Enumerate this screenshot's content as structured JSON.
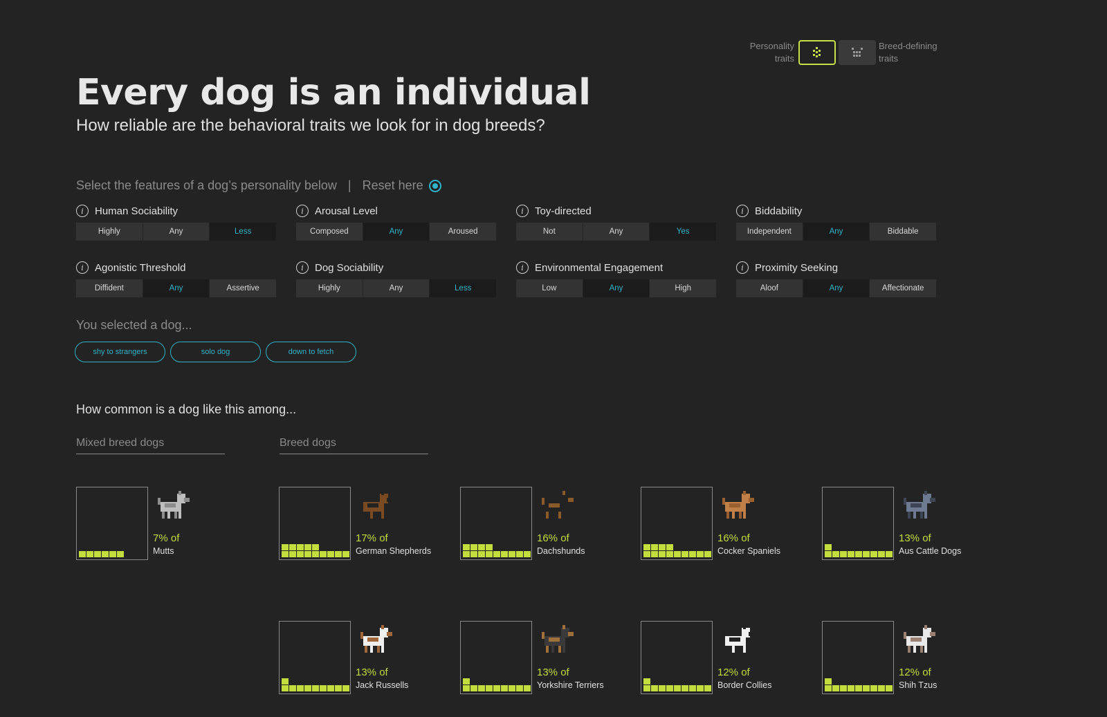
{
  "toggle": {
    "left_label_1": "Personality",
    "left_label_2": "traits",
    "right_label_1": "Breed-defining",
    "right_label_2": "traits"
  },
  "header": {
    "title": "Every dog is an individual",
    "subtitle": "How reliable are the behavioral traits we look for in dog breeds?"
  },
  "selector": {
    "prompt": "Select the features of a dog’s personality below",
    "separator": "|",
    "reset": "Reset here"
  },
  "traits": [
    {
      "name": "Human Sociability",
      "options": [
        "Highly",
        "Any",
        "Less"
      ],
      "selected": 2
    },
    {
      "name": "Arousal Level",
      "options": [
        "Composed",
        "Any",
        "Aroused"
      ],
      "selected": 1
    },
    {
      "name": "Toy-directed",
      "options": [
        "Not",
        "Any",
        "Yes"
      ],
      "selected": 2
    },
    {
      "name": "Biddability",
      "options": [
        "Independent",
        "Any",
        "Biddable"
      ],
      "selected": 1
    },
    {
      "name": "Agonistic Threshold",
      "options": [
        "Diffident",
        "Any",
        "Assertive"
      ],
      "selected": 1
    },
    {
      "name": "Dog Sociability",
      "options": [
        "Highly",
        "Any",
        "Less"
      ],
      "selected": 2
    },
    {
      "name": "Environmental Engagement",
      "options": [
        "Low",
        "Any",
        "High"
      ],
      "selected": 1
    },
    {
      "name": "Proximity Seeking",
      "options": [
        "Aloof",
        "Any",
        "Affectionate"
      ],
      "selected": 1
    }
  ],
  "selection": {
    "label": "You selected a dog...",
    "chips": [
      "shy to strangers",
      "solo dog",
      "down to fetch"
    ]
  },
  "results": {
    "heading": "How common is a dog like this among...",
    "mixed_header": "Mixed breed dogs",
    "breed_header": "Breed dogs",
    "mixed": {
      "pct": "7% of",
      "name": "Mutts",
      "value": 7,
      "icon": "mutts-icon"
    },
    "breeds": [
      {
        "pct": "17% of",
        "name": "German Shepherds",
        "value": 17,
        "icon": "german-shepherd-icon"
      },
      {
        "pct": "16% of",
        "name": "Dachshunds",
        "value": 16,
        "icon": "dachshund-icon"
      },
      {
        "pct": "16% of",
        "name": "Cocker Spaniels",
        "value": 16,
        "icon": "cocker-spaniel-icon"
      },
      {
        "pct": "13% of",
        "name": "Aus Cattle Dogs",
        "value": 13,
        "icon": "aus-cattle-dog-icon"
      },
      {
        "pct": "13% of",
        "name": "Jack Russells",
        "value": 13,
        "icon": "jack-russell-icon"
      },
      {
        "pct": "13% of",
        "name": "Yorkshire Terriers",
        "value": 13,
        "icon": "yorkshire-terrier-icon"
      },
      {
        "pct": "12% of",
        "name": "Border Collies",
        "value": 12,
        "icon": "border-collie-icon"
      },
      {
        "pct": "12% of",
        "name": "Shih Tzus",
        "value": 12,
        "icon": "shih-tzu-icon"
      }
    ]
  },
  "colors": {
    "background": "#232323",
    "accent_lime": "#c3dc3e",
    "accent_teal": "#2fb3c9"
  }
}
